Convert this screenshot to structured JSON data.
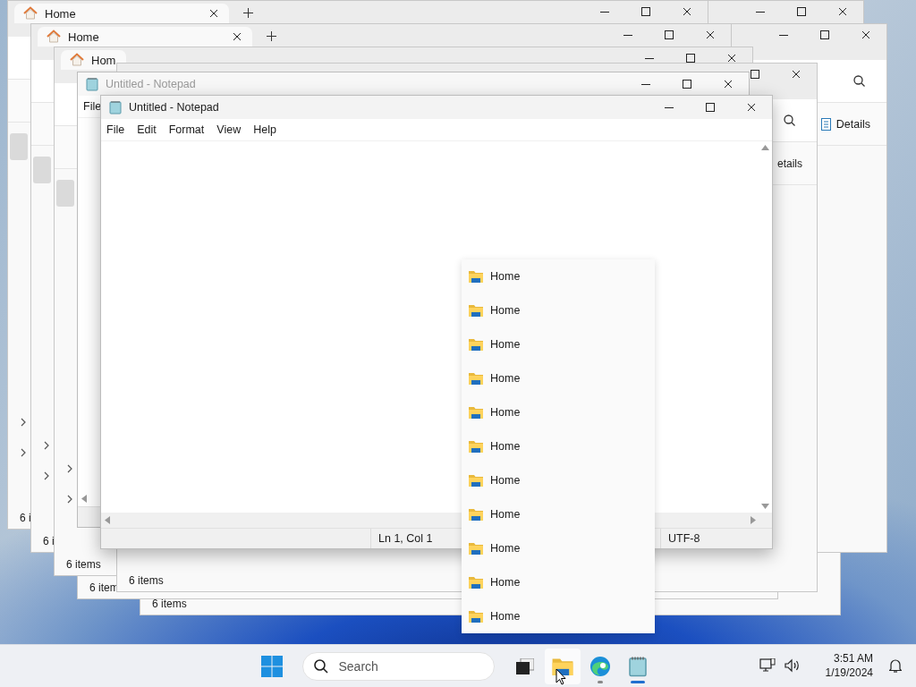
{
  "explorer_windows": [
    {
      "status": "6 items"
    },
    {
      "status": "6 item"
    },
    {
      "caption_buttons": [
        {
          "kind": "minimize"
        },
        {
          "kind": "maximize"
        },
        {
          "kind": "close"
        }
      ]
    },
    {
      "tab": {
        "title": "Home",
        "close": true
      },
      "caption_buttons": [
        {
          "kind": "minimize"
        },
        {
          "kind": "maximize"
        },
        {
          "kind": "close"
        }
      ],
      "sidebar": true,
      "status": "6 i"
    },
    {
      "caption_buttons": [
        {
          "kind": "minimize"
        },
        {
          "kind": "maximize"
        },
        {
          "kind": "close"
        }
      ],
      "search": true,
      "details_icon": true,
      "details": "Details"
    },
    {
      "tab": {
        "title": "Home",
        "close": true
      },
      "caption_buttons": [
        {
          "kind": "minimize"
        },
        {
          "kind": "maximize"
        },
        {
          "kind": "close"
        }
      ],
      "sidebar": true,
      "status": "6 i"
    },
    {
      "tab": {
        "title": "Hom",
        "close": false
      },
      "caption_buttons": [
        {
          "kind": "minimize"
        },
        {
          "kind": "maximize"
        },
        {
          "kind": "close"
        }
      ],
      "sidebar": true,
      "status": "6 items"
    },
    {
      "caption_buttons": [
        {
          "kind": "maximize"
        },
        {
          "kind": "close"
        }
      ],
      "search": true,
      "details": "etails",
      "status": "6 items"
    }
  ],
  "notepad_windows": [
    {
      "title": "Untitled - Notepad",
      "active": false,
      "menu": [
        "File"
      ]
    },
    {
      "title": "Untitled - Notepad",
      "active": true,
      "menu": [
        "File",
        "Edit",
        "Format",
        "View",
        "Help"
      ],
      "status": {
        "position": "Ln 1, Col 1",
        "encoding": "UTF-8"
      }
    }
  ],
  "jump_list": {
    "items": [
      "Home",
      "Home",
      "Home",
      "Home",
      "Home",
      "Home",
      "Home",
      "Home",
      "Home",
      "Home",
      "Home"
    ]
  },
  "taskbar": {
    "search_placeholder": "Search",
    "apps": [
      {
        "kind": "task-view",
        "hovered": false,
        "running": false,
        "active": false
      },
      {
        "kind": "explorer",
        "hovered": true,
        "running": false,
        "active": false
      },
      {
        "kind": "edge",
        "hovered": false,
        "running": true,
        "active": false
      },
      {
        "kind": "notepad",
        "hovered": false,
        "running": true,
        "active": true
      }
    ],
    "time": "3:51 AM",
    "date": "1/19/2024"
  }
}
